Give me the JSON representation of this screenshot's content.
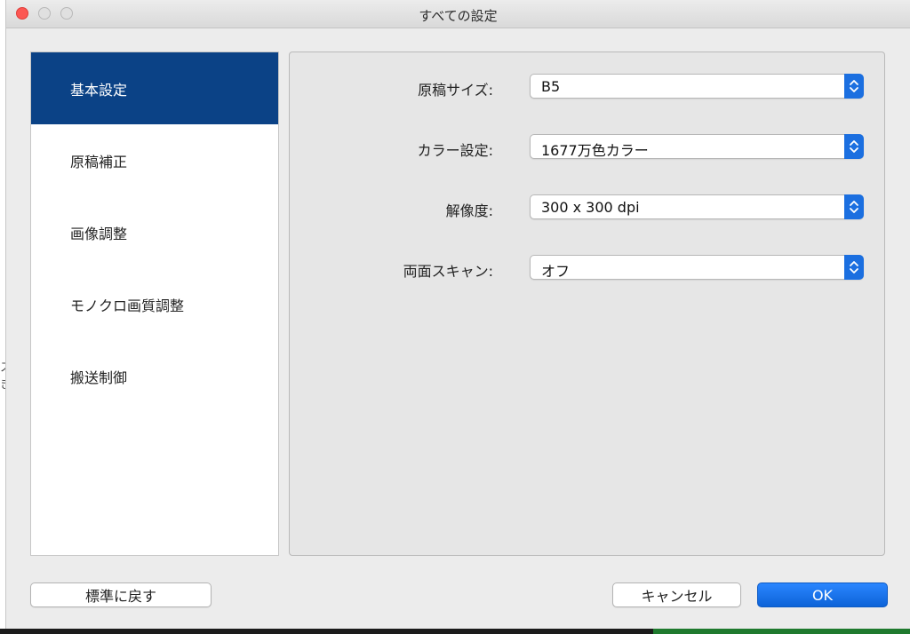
{
  "window": {
    "title": "すべての設定"
  },
  "sidebar": {
    "items": [
      {
        "label": "基本設定",
        "active": true
      },
      {
        "label": "原稿補正",
        "active": false
      },
      {
        "label": "画像調整",
        "active": false
      },
      {
        "label": "モノクロ画質調整",
        "active": false
      },
      {
        "label": "搬送制御",
        "active": false
      }
    ]
  },
  "settings": [
    {
      "label": "原稿サイズ:",
      "value": "B5"
    },
    {
      "label": "カラー設定:",
      "value": "1677万色カラー"
    },
    {
      "label": "解像度:",
      "value": "300 x 300 dpi"
    },
    {
      "label": "両面スキャン:",
      "value": "オフ"
    }
  ],
  "buttons": {
    "reset_label": "標準に戻す",
    "cancel_label": "キャンセル",
    "ok_label": "OK"
  },
  "background": {
    "glyph_1": "ス",
    "glyph_2": "き"
  },
  "colors": {
    "accent": "#0b4286",
    "primary_button": "#1b6fe0",
    "close_button": "#fc5753"
  },
  "icons": {
    "select_arrow": "chevron-up-down-icon"
  }
}
